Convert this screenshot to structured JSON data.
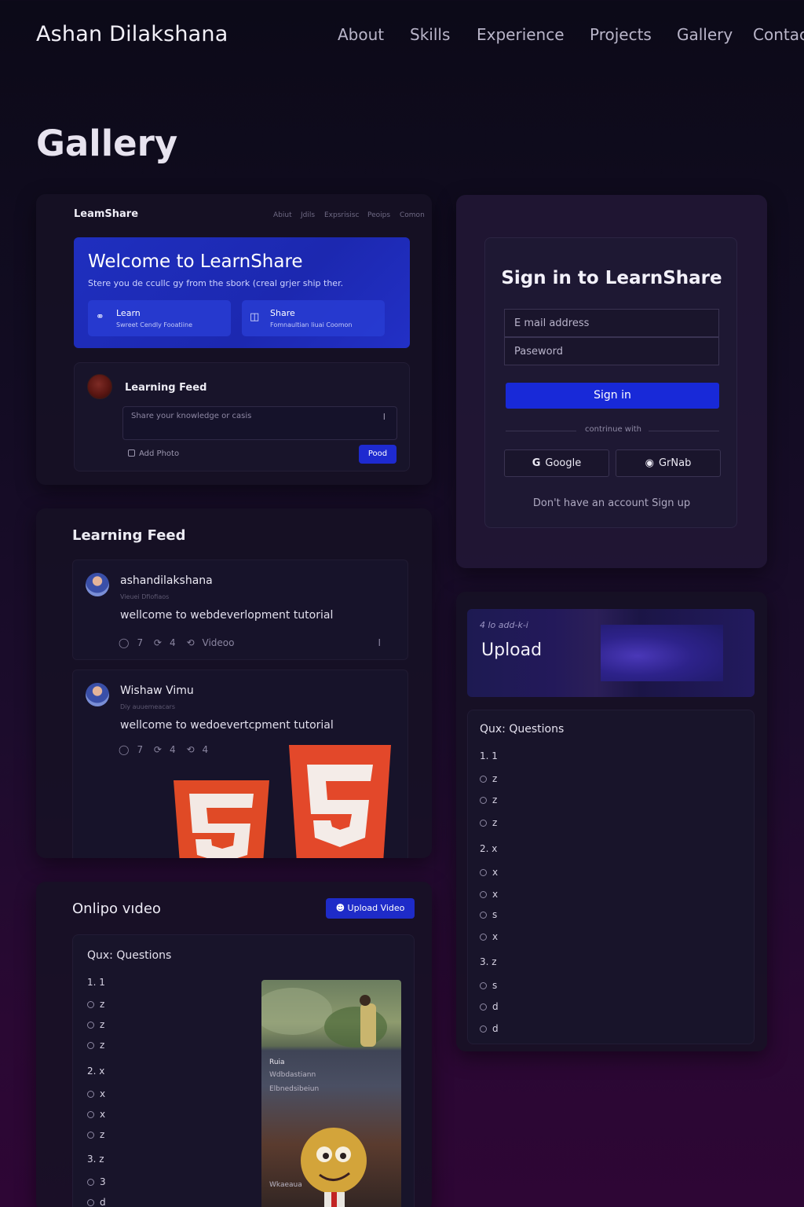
{
  "nav": {
    "brand": "Ashan Dilakshana",
    "links": [
      "About",
      "Skills",
      "Experience",
      "Projects",
      "Gallery",
      "Contac"
    ]
  },
  "page": {
    "title": "Gallery"
  },
  "card1": {
    "brand": "LeamShare",
    "nav": [
      "Abiut",
      "Jdils",
      "Expsrisisc",
      "Peoips",
      "Comon"
    ],
    "hero_title": "Welcome to LearnShare",
    "hero_sub": "Stere you de ccullc gy from the sbork (creal grjer ship ther.",
    "tile_learn_title": "Learn",
    "tile_learn_sub": "Swreet Cendly Fooatiine",
    "tile_share_title": "Share",
    "tile_share_sub": "Fomnaultian liuai Coomon",
    "feed_title": "Learning Feed",
    "feed_placeholder": "Share your knowledge or casis",
    "add_photo": "Add Photo",
    "post_button": "Pood"
  },
  "feed": {
    "title": "Learning Feed",
    "posts": [
      {
        "name": "ashandilakshana",
        "sub": "Vieuei Dfiofiaos",
        "text": "wellcome to webdeverlopment tutorial",
        "likes": "7",
        "shares": "4",
        "extra": "Videoo"
      },
      {
        "name": "Wishaw Vimu",
        "sub": "Diy auuemeacars",
        "text": "wellcome to wedoevertcpment tutorial",
        "likes": "7",
        "shares": "4",
        "extra": "4"
      }
    ]
  },
  "video": {
    "title": "Onlipo vıdeo",
    "upload_button": "Upload Video",
    "quiz_title": "Qux: Questions",
    "quiz": [
      {
        "q": "1. 1",
        "options": [
          "z",
          "z",
          "z"
        ]
      },
      {
        "q": "2. x",
        "options": [
          "x",
          "x",
          "z"
        ]
      },
      {
        "q": "3. z",
        "options": [
          "3",
          "d"
        ]
      }
    ],
    "thumb_label1": "Ruia",
    "thumb_label2": "Wdbdastiann",
    "thumb_label3": "Elbnedsibeiun",
    "thumb_label4": "Wkaeaua"
  },
  "signin": {
    "title": "Sign in to LearnShare",
    "email_placeholder": "E mail address",
    "password_placeholder": "Paseword",
    "button": "Sign in",
    "divider": "contrinue with",
    "google": "Google",
    "github": "GrNab",
    "footer": "Don't have an account  Sign up"
  },
  "upload_card": {
    "small": "4 lo add-k-i",
    "title": "Upload",
    "quiz_title": "Qux: Questions",
    "quiz": [
      {
        "q": "1. 1",
        "options": [
          "z",
          "z",
          "z"
        ]
      },
      {
        "q": "2. x",
        "options": [
          "x",
          "x",
          "s",
          "x"
        ]
      },
      {
        "q": "3. z",
        "options": [
          "s",
          "d",
          "d"
        ]
      }
    ]
  },
  "colors": {
    "accent": "#1e2ad0",
    "background_top": "#0c0a18",
    "background_bottom": "#2e0635"
  },
  "icons": [
    "link-icon",
    "book-icon",
    "comment-icon",
    "share-icon",
    "refresh-icon",
    "user-icon",
    "google-icon",
    "github-icon"
  ]
}
